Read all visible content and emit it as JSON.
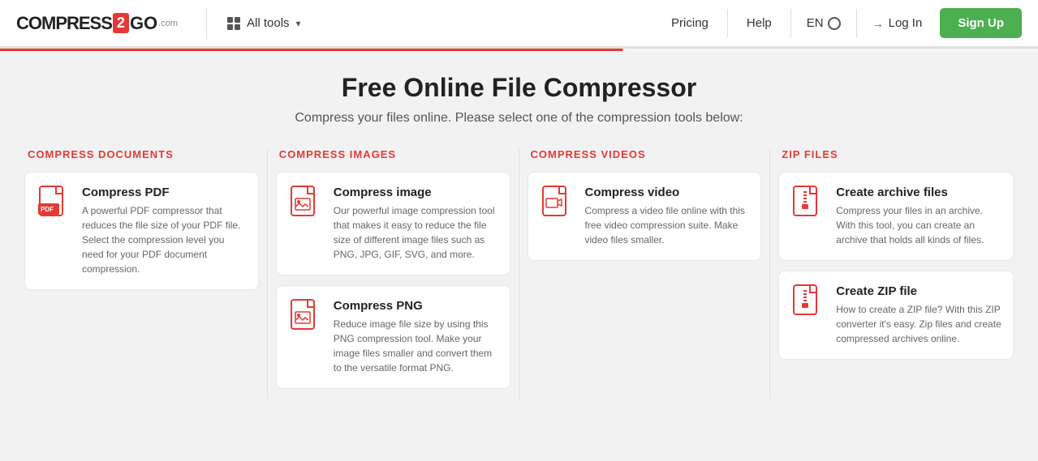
{
  "header": {
    "logo": {
      "part1": "COMPRESS",
      "box": "2",
      "part2": "GO",
      "com": ".com"
    },
    "all_tools_label": "All tools",
    "nav": {
      "pricing": "Pricing",
      "help": "Help",
      "lang": "EN",
      "login": "Log In",
      "signup": "Sign Up"
    }
  },
  "main": {
    "title": "Free Online File Compressor",
    "subtitle": "Compress your files online. Please select one of the compression tools below:",
    "columns": [
      {
        "title": "COMPRESS DOCUMENTS",
        "cards": [
          {
            "title": "Compress PDF",
            "desc": "A powerful PDF compressor that reduces the file size of your PDF file. Select the compression level you need for your PDF document compression.",
            "icon_type": "pdf"
          }
        ]
      },
      {
        "title": "COMPRESS IMAGES",
        "cards": [
          {
            "title": "Compress image",
            "desc": "Our powerful image compression tool that makes it easy to reduce the file size of different image files such as PNG, JPG, GIF, SVG, and more.",
            "icon_type": "image"
          },
          {
            "title": "Compress PNG",
            "desc": "Reduce image file size by using this PNG compression tool. Make your image files smaller and convert them to the versatile format PNG.",
            "icon_type": "png"
          }
        ]
      },
      {
        "title": "COMPRESS VIDEOS",
        "cards": [
          {
            "title": "Compress video",
            "desc": "Compress a video file online with this free video compression suite. Make video files smaller.",
            "icon_type": "video"
          }
        ]
      },
      {
        "title": "ZIP FILES",
        "cards": [
          {
            "title": "Create archive files",
            "desc": "Compress your files in an archive. With this tool, you can create an archive that holds all kinds of files.",
            "icon_type": "archive"
          },
          {
            "title": "Create ZIP file",
            "desc": "How to create a ZIP file? With this ZIP converter it's easy. Zip files and create compressed archives online.",
            "icon_type": "zip"
          }
        ]
      }
    ]
  }
}
